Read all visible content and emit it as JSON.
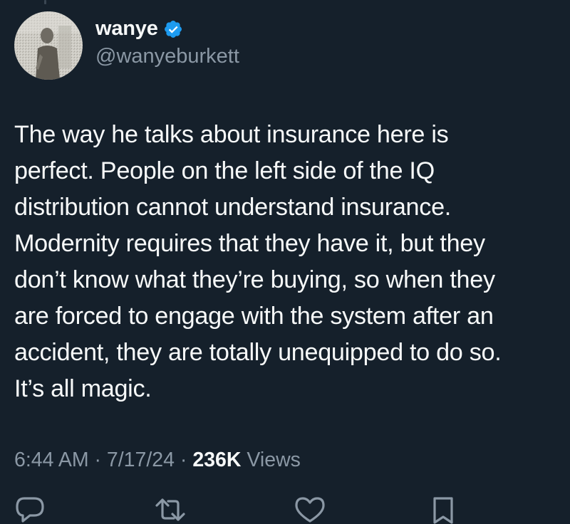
{
  "user": {
    "display_name": "wanye",
    "handle": "@wanyeburkett",
    "verified": true,
    "verified_color": "#1d9bf0",
    "avatar_icon": "avatar"
  },
  "tweet": {
    "lines": [
      "The way he talks about insurance here is",
      "perfect. People on the left side of the IQ",
      "distribution cannot understand insurance.",
      "Modernity requires that they have it, but they",
      "don’t know what they’re buying, so when they",
      "are forced to engage with the system after an",
      "accident, they are totally unequipped to do so.",
      "It’s all magic."
    ]
  },
  "meta": {
    "time": "6:44 AM",
    "sep1": " · ",
    "date": "7/17/24",
    "sep2": " · ",
    "views_count": "236K",
    "views_label": " Views"
  },
  "actions": [
    {
      "name": "reply",
      "icon": "reply-icon"
    },
    {
      "name": "retweet",
      "icon": "retweet-icon"
    },
    {
      "name": "like",
      "icon": "heart-icon"
    },
    {
      "name": "bookmark",
      "icon": "bookmark-icon"
    }
  ],
  "colors": {
    "background": "#15202b",
    "text": "#f7f9f9",
    "secondary": "#8b98a5"
  }
}
